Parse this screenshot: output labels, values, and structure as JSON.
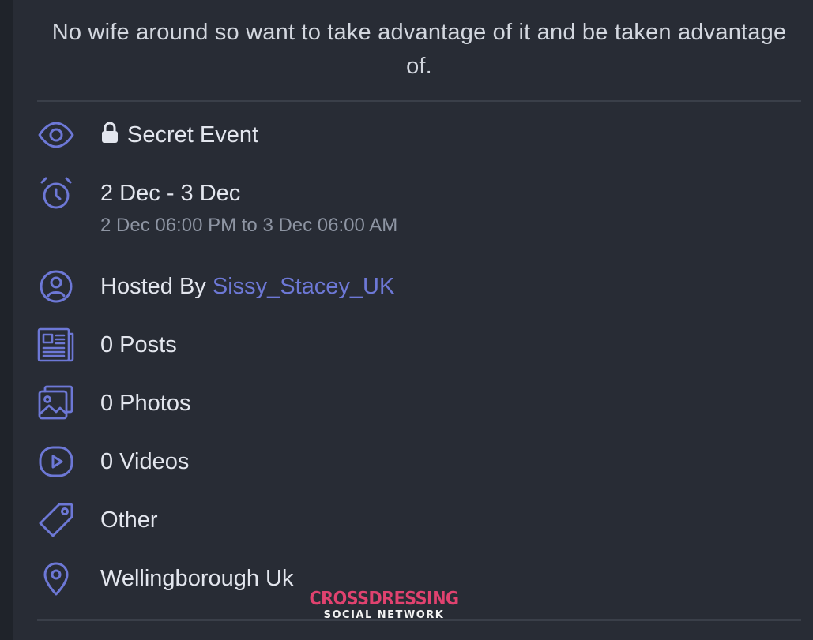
{
  "event": {
    "description": "No wife around so want to take advantage of it and be taken advantage of.",
    "privacy": "Secret Event",
    "date_range": "2 Dec - 3 Dec",
    "date_detail": "2 Dec 06:00 PM to 3 Dec 06:00 AM",
    "hosted_by_label": "Hosted By",
    "host_name": "Sissy_Stacey_UK",
    "posts": "0 Posts",
    "photos": "0 Photos",
    "videos": "0 Videos",
    "category": "Other",
    "location": "Wellingborough Uk"
  },
  "watermark": {
    "title": "CROSSDRESSING",
    "subtitle": "SOCIAL NETWORK"
  },
  "icons": {
    "privacy": "eye-icon",
    "lock": "lock-icon",
    "time": "alarm-clock-icon",
    "host": "user-circle-icon",
    "posts": "newspaper-icon",
    "photos": "photos-icon",
    "videos": "video-play-icon",
    "category": "tag-icon",
    "location": "map-pin-icon"
  },
  "colors": {
    "background": "#282c35",
    "icon_accent": "#6d78d6",
    "link": "#6d78d6",
    "text": "#e3e6ee",
    "muted_text": "#8e95a3",
    "watermark": "#e0426f"
  }
}
